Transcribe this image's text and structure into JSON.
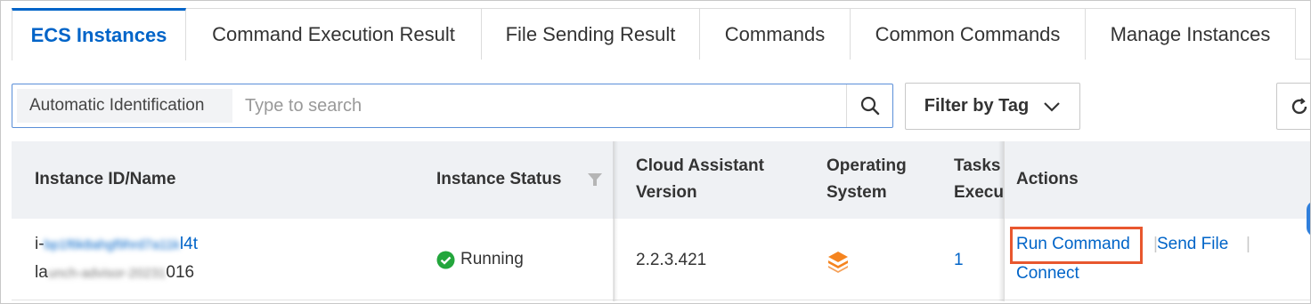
{
  "tabs": [
    {
      "label": "ECS Instances",
      "active": true
    },
    {
      "label": "Command Execution Result",
      "active": false
    },
    {
      "label": "File Sending Result",
      "active": false
    },
    {
      "label": "Commands",
      "active": false
    },
    {
      "label": "Common Commands",
      "active": false
    },
    {
      "label": "Manage Instances",
      "active": false
    }
  ],
  "search": {
    "prefix": "Automatic Identification",
    "placeholder": "Type to search",
    "value": ""
  },
  "filter": {
    "label": "Filter by Tag"
  },
  "table": {
    "columns": {
      "instance": "Instance ID/Name",
      "status": "Instance Status",
      "version_line1": "Cloud Assistant",
      "version_line2": "Version",
      "os_line1": "Operating",
      "os_line2": "System",
      "tasks_line1": "Tasks",
      "tasks_line2": "Execut",
      "actions": "Actions"
    },
    "rows": [
      {
        "id_prefix": "i-",
        "id_masked": "bp1f6k8ahgf9hrd7a11k",
        "id_suffix": "l4t",
        "name_prefix": "la",
        "name_masked": "unch-advisor-20231",
        "name_mid": "0",
        "name_suffix": "16",
        "status": "Running",
        "version": "2.2.3.421",
        "tasks": "1",
        "actions": {
          "run": "Run Command",
          "send": "Send File",
          "connect": "Connect"
        }
      }
    ]
  },
  "colors": {
    "accent": "#0064c8",
    "highlight": "#e8572e",
    "running": "#23a63c",
    "os_icon": "#f5841f"
  }
}
